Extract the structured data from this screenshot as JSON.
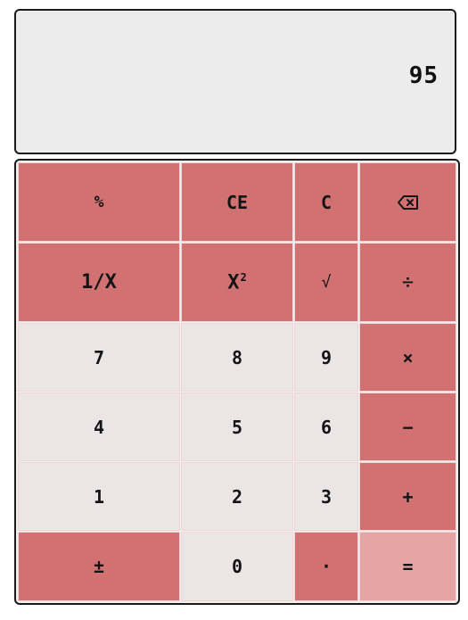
{
  "display": {
    "value": "95"
  },
  "keys": {
    "percent": "%",
    "clear_entry": "CE",
    "clear": "C",
    "backspace_icon": "backspace-icon",
    "reciprocal": "1/X",
    "square_base": "X",
    "square_exp": "2",
    "sqrt": "√",
    "divide": "÷",
    "seven": "7",
    "eight": "8",
    "nine": "9",
    "multiply": "×",
    "four": "4",
    "five": "5",
    "six": "6",
    "minus": "−",
    "one": "1",
    "two": "2",
    "three": "3",
    "plus": "+",
    "negate": "±",
    "zero": "0",
    "decimal": "·",
    "equals": "="
  },
  "colors": {
    "operator_key": "#d27171",
    "number_key": "#ece5e5",
    "equals_key": "#e6a4a4",
    "display_bg": "#ececec"
  }
}
